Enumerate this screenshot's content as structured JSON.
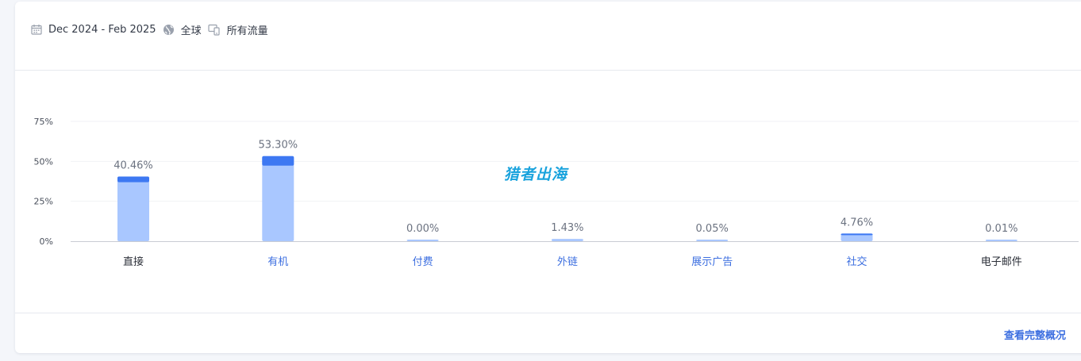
{
  "filters": {
    "date_range": "Dec 2024 - Feb 2025",
    "region": "全球",
    "traffic": "所有流量"
  },
  "watermark": "猎者出海",
  "footer": {
    "link_label": "查看完整概况"
  },
  "colors": {
    "bar_light": "#a9c7ff",
    "bar_dark": "#3d78f2",
    "label_link": "#3d6fe0",
    "label_plain": "#2b2f38",
    "value_text": "#6b7280",
    "grid": "#f1f2f5",
    "axis": "#c9ccd4"
  },
  "chart_data": {
    "type": "bar",
    "categories": [
      "直接",
      "有机",
      "付费",
      "外链",
      "展示广告",
      "社交",
      "电子邮件"
    ],
    "values": [
      40.46,
      53.3,
      0.0,
      1.43,
      0.05,
      4.76,
      0.01
    ],
    "value_labels": [
      "40.46%",
      "53.30%",
      "0.00%",
      "1.43%",
      "0.05%",
      "4.76%",
      "0.01%"
    ],
    "highlight_values": [
      3.5,
      6.0,
      0.0,
      0.0,
      0.0,
      1.0,
      0.0
    ],
    "linked_categories": [
      false,
      true,
      true,
      true,
      true,
      true,
      false
    ],
    "yticks": [
      0,
      25,
      50,
      75
    ],
    "ytick_labels": [
      "0%",
      "25%",
      "50%",
      "75%"
    ],
    "ylim": [
      0,
      75
    ],
    "grid": true
  }
}
